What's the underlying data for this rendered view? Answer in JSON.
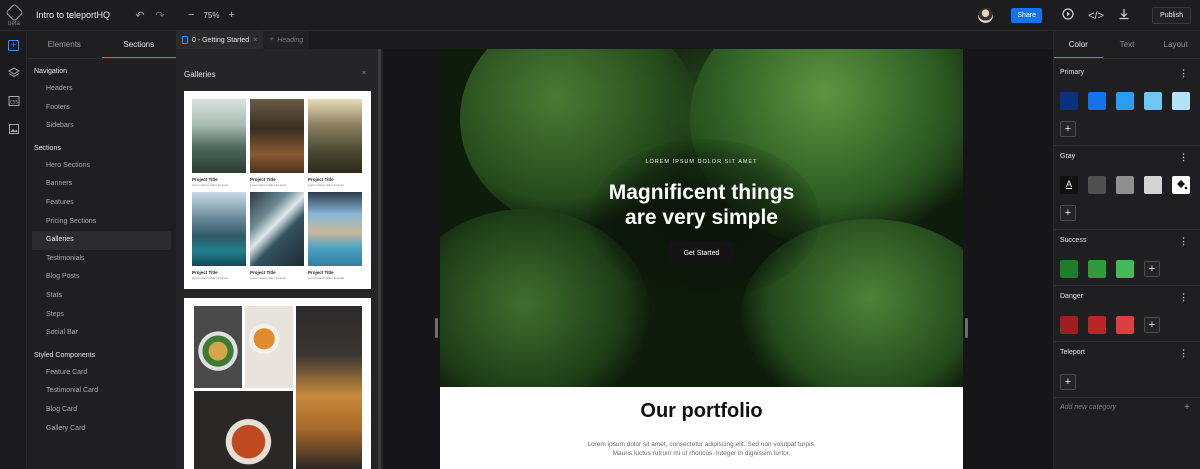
{
  "app": {
    "beta_label": "beta",
    "project_title": "Intro to teleportHQ"
  },
  "toolbar": {
    "undo_icon": "undo-icon",
    "redo_icon": "redo-icon",
    "zoom_out": "−",
    "zoom_level": "75%",
    "zoom_in": "+",
    "share_label": "Share",
    "publish_label": "Publish"
  },
  "left_panel": {
    "tabs": [
      "Elements",
      "Sections"
    ],
    "groups": [
      {
        "label": "Navigation",
        "items": [
          "Headers",
          "Footers",
          "Sidebars"
        ]
      },
      {
        "label": "Sections",
        "items": [
          "Hero Sections",
          "Banners",
          "Features",
          "Pricing Sections",
          "Galleries",
          "Testimonials",
          "Blog Posts",
          "Stats",
          "Steps",
          "Social Bar"
        ]
      },
      {
        "label": "Styled Components",
        "items": [
          "Feature Card",
          "Testimonial Card",
          "Blog Card",
          "Gallery Card"
        ]
      }
    ],
    "selected_item": "Galleries"
  },
  "document_tabs": [
    {
      "label": "0 - Getting Started",
      "close": "×"
    },
    {
      "label": "Heading"
    }
  ],
  "galleries_panel": {
    "title": "Galleries",
    "close": "×",
    "cards": [
      {
        "caption": "Project Title",
        "sub": "Lorem ipsum dolor sit amet"
      },
      {
        "caption": "Project Title",
        "sub": "Lorem ipsum dolor sit amet"
      },
      {
        "caption": "Project Title",
        "sub": "Lorem ipsum dolor sit amet"
      },
      {
        "caption": "Project Title",
        "sub": "Lorem ipsum dolor sit amet"
      },
      {
        "caption": "Project Title",
        "sub": "Lorem ipsum dolor sit amet"
      },
      {
        "caption": "Project Title",
        "sub": "Lorem ipsum dolor sit amet"
      }
    ]
  },
  "canvas": {
    "hero": {
      "eyebrow": "LOREM IPSUM DOLOR SIT AMET",
      "title_line1": "Magnificent things",
      "title_line2": "are very simple",
      "button": "Get Started"
    },
    "portfolio": {
      "title": "Our portfolio",
      "text_line1": "Lorem ipsum dolor sit amet, consectetur adipiscing elit. Sed non volutpat turpis.",
      "text_line2": "Mauris luctus rutrum mi ut rhoncus. Integer in dignissim tortor."
    }
  },
  "right_panel": {
    "tabs": [
      "Color",
      "Text",
      "Layout"
    ],
    "categories": [
      {
        "label": "Primary",
        "colors": [
          "#0b3080",
          "#1472ee",
          "#2a9cf2",
          "#6fc6f2",
          "#b3e1f7"
        ]
      },
      {
        "label": "Gray",
        "colors": [
          "#111111",
          "#505050",
          "#8f8f8f",
          "#d4d4d4",
          "#ffffff"
        ]
      },
      {
        "label": "Success",
        "colors": [
          "#1e7a2c",
          "#2e9a3d",
          "#43b957"
        ]
      },
      {
        "label": "Danger",
        "colors": [
          "#9c1e1e",
          "#b82626",
          "#dd3f3f"
        ]
      },
      {
        "label": "Teleport",
        "colors": []
      }
    ],
    "menu_glyph": "⋮",
    "add_glyph": "+",
    "text_swatch_glyph": "A",
    "add_category": "Add new category"
  }
}
